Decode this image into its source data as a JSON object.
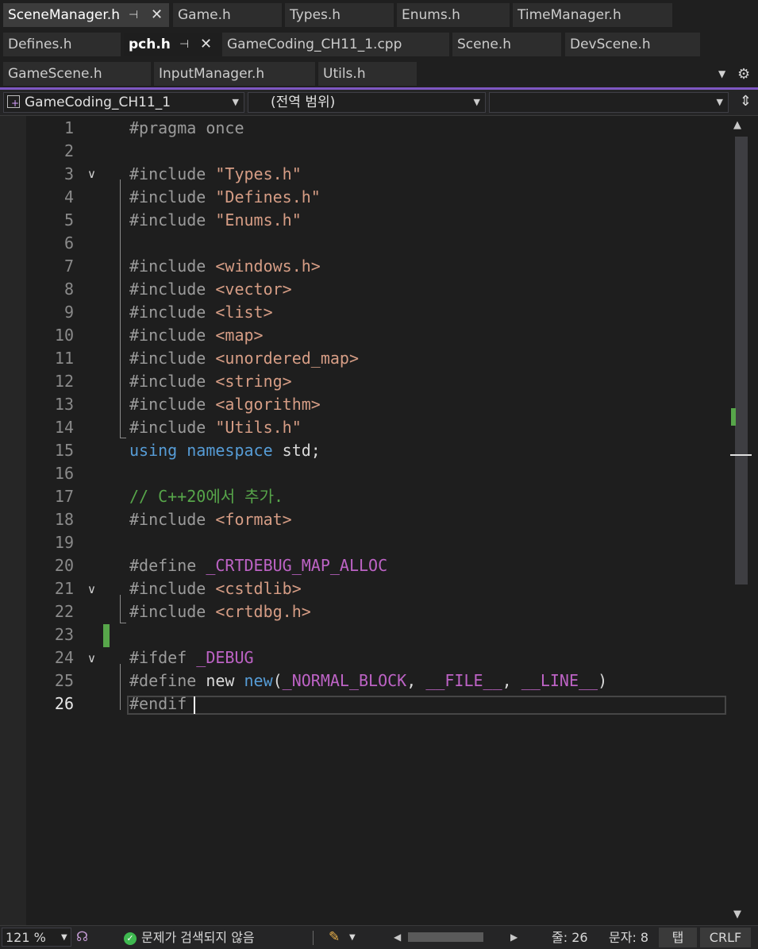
{
  "tabs_row1": [
    {
      "label": "SceneManager.h"
    },
    {
      "label": "Game.h"
    },
    {
      "label": "Types.h"
    },
    {
      "label": "Enums.h"
    },
    {
      "label": "TimeManager.h"
    }
  ],
  "tabs_row2": [
    {
      "label": "Defines.h"
    },
    {
      "label": "pch.h"
    },
    {
      "label": "GameCoding_CH11_1.cpp"
    },
    {
      "label": "Scene.h"
    },
    {
      "label": "DevScene.h"
    }
  ],
  "tabs_row3": [
    {
      "label": "GameScene.h"
    },
    {
      "label": "InputManager.h"
    },
    {
      "label": "Utils.h"
    }
  ],
  "icons": {
    "pin": "pin-icon",
    "close": "close-icon",
    "dropdown": "chevron-down-icon",
    "settings": "gear-icon"
  },
  "navbar": {
    "project": "GameCoding_CH11_1",
    "scope": "(전역 범위)",
    "member": ""
  },
  "editor": {
    "current_line": 26,
    "lines": [
      {
        "n": "1",
        "tokens": [
          {
            "t": "#pragma once",
            "c": "pp"
          }
        ]
      },
      {
        "n": "2",
        "tokens": []
      },
      {
        "n": "3",
        "tokens": [
          {
            "t": "#include ",
            "c": "pp"
          },
          {
            "t": "\"Types.h\"",
            "c": "str"
          }
        ]
      },
      {
        "n": "4",
        "tokens": [
          {
            "t": "#include ",
            "c": "pp"
          },
          {
            "t": "\"Defines.h\"",
            "c": "str"
          }
        ]
      },
      {
        "n": "5",
        "tokens": [
          {
            "t": "#include ",
            "c": "pp"
          },
          {
            "t": "\"Enums.h\"",
            "c": "str"
          }
        ]
      },
      {
        "n": "6",
        "tokens": []
      },
      {
        "n": "7",
        "tokens": [
          {
            "t": "#include ",
            "c": "pp"
          },
          {
            "t": "<windows.h>",
            "c": "str"
          }
        ]
      },
      {
        "n": "8",
        "tokens": [
          {
            "t": "#include ",
            "c": "pp"
          },
          {
            "t": "<vector>",
            "c": "str"
          }
        ]
      },
      {
        "n": "9",
        "tokens": [
          {
            "t": "#include ",
            "c": "pp"
          },
          {
            "t": "<list>",
            "c": "str"
          }
        ]
      },
      {
        "n": "10",
        "tokens": [
          {
            "t": "#include ",
            "c": "pp"
          },
          {
            "t": "<map>",
            "c": "str"
          }
        ]
      },
      {
        "n": "11",
        "tokens": [
          {
            "t": "#include ",
            "c": "pp"
          },
          {
            "t": "<unordered_map>",
            "c": "str"
          }
        ]
      },
      {
        "n": "12",
        "tokens": [
          {
            "t": "#include ",
            "c": "pp"
          },
          {
            "t": "<string>",
            "c": "str"
          }
        ]
      },
      {
        "n": "13",
        "tokens": [
          {
            "t": "#include ",
            "c": "pp"
          },
          {
            "t": "<algorithm>",
            "c": "str"
          }
        ]
      },
      {
        "n": "14",
        "tokens": [
          {
            "t": "#include ",
            "c": "pp"
          },
          {
            "t": "\"Utils.h\"",
            "c": "str"
          }
        ]
      },
      {
        "n": "15",
        "tokens": [
          {
            "t": "using",
            "c": "kw"
          },
          {
            "t": " ",
            "c": "tx"
          },
          {
            "t": "namespace",
            "c": "kw"
          },
          {
            "t": " std;",
            "c": "tx"
          }
        ]
      },
      {
        "n": "16",
        "tokens": []
      },
      {
        "n": "17",
        "tokens": [
          {
            "t": "// C++20에서 추가.",
            "c": "cm"
          }
        ]
      },
      {
        "n": "18",
        "tokens": [
          {
            "t": "#include ",
            "c": "pp"
          },
          {
            "t": "<format>",
            "c": "str"
          }
        ]
      },
      {
        "n": "19",
        "tokens": []
      },
      {
        "n": "20",
        "tokens": [
          {
            "t": "#define ",
            "c": "pp"
          },
          {
            "t": "_CRTDEBUG_MAP_ALLOC",
            "c": "mac"
          }
        ]
      },
      {
        "n": "21",
        "tokens": [
          {
            "t": "#include ",
            "c": "pp"
          },
          {
            "t": "<cstdlib>",
            "c": "str"
          }
        ]
      },
      {
        "n": "22",
        "tokens": [
          {
            "t": "#include ",
            "c": "pp"
          },
          {
            "t": "<crtdbg.h>",
            "c": "str"
          }
        ]
      },
      {
        "n": "23",
        "tokens": []
      },
      {
        "n": "24",
        "tokens": [
          {
            "t": "#ifdef ",
            "c": "pp"
          },
          {
            "t": "_DEBUG",
            "c": "mac"
          }
        ]
      },
      {
        "n": "25",
        "tokens": [
          {
            "t": "#define ",
            "c": "pp"
          },
          {
            "t": "new ",
            "c": "tx"
          },
          {
            "t": "new",
            "c": "kw"
          },
          {
            "t": "(",
            "c": "tx"
          },
          {
            "t": "_NORMAL_BLOCK",
            "c": "mac"
          },
          {
            "t": ", ",
            "c": "tx"
          },
          {
            "t": "__FILE__",
            "c": "mac"
          },
          {
            "t": ", ",
            "c": "tx"
          },
          {
            "t": "__LINE__",
            "c": "mac"
          },
          {
            "t": ")",
            "c": "tx"
          }
        ]
      },
      {
        "n": "26",
        "tokens": [
          {
            "t": "#endif ",
            "c": "pp"
          }
        ]
      }
    ]
  },
  "status": {
    "zoom": "121 %",
    "issues": "문제가 검색되지 않음",
    "line": "줄: 26",
    "char": "문자: 8",
    "indent": "탭",
    "eol": "CRLF"
  },
  "colors": {
    "accent": "#7e57c2",
    "preprocessor": "#9b9b9b",
    "string": "#d69d85",
    "keyword": "#569cd6",
    "macro": "#bd63c5",
    "comment": "#57a64a",
    "change_marker": "#57a64a"
  }
}
